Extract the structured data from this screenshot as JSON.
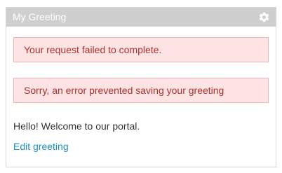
{
  "portlet": {
    "title": "My Greeting",
    "options_icon": "gear-icon"
  },
  "alerts": [
    {
      "text": "Your request failed to complete."
    },
    {
      "text": "Sorry, an error prevented saving your greeting"
    }
  ],
  "greeting": {
    "message": "Hello! Welcome to our portal.",
    "edit_link": "Edit greeting"
  },
  "colors": {
    "header_bg": "#cfcfcf",
    "alert_bg": "#fde3e3",
    "alert_border": "#eeb4b4",
    "alert_text": "#b0302c",
    "link": "#1c8fc3"
  }
}
